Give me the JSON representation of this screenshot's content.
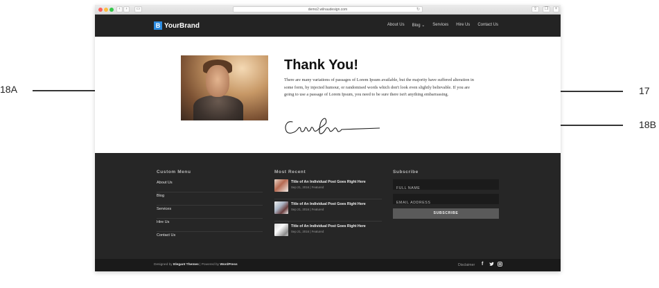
{
  "annotations": [
    {
      "id": "18A",
      "label": "18A"
    },
    {
      "id": "17",
      "label": "17"
    },
    {
      "id": "18B",
      "label": "18B"
    }
  ],
  "browser": {
    "url": "demo2.wilnaudesign.com"
  },
  "header": {
    "logo_mark": "B",
    "brand": "YourBrand",
    "nav": [
      {
        "label": "About Us"
      },
      {
        "label": "Blog ⌄"
      },
      {
        "label": "Services"
      },
      {
        "label": "Hire Us"
      },
      {
        "label": "Contact Us"
      }
    ]
  },
  "hero": {
    "title": "Thank You!",
    "body": "There are many variations of passages of Lorem Ipsum available, but the majority have suffered alteration in some form, by injected humour, or randomised words which don't look even slightly believable. If you are going to use a passage of Lorem Ipsum, you need to be sure there isn't anything embarrassing."
  },
  "footer": {
    "custom_menu": {
      "title": "Custom Menu",
      "items": [
        {
          "label": "About Us"
        },
        {
          "label": "Blog"
        },
        {
          "label": "Services"
        },
        {
          "label": "Hire Us"
        },
        {
          "label": "Contact Us"
        }
      ]
    },
    "most_recent": {
      "title": "Most Recent",
      "posts": [
        {
          "title": "Title of An Individual Post Goes Right Here",
          "meta": "Sep 21, 2016 | Featured"
        },
        {
          "title": "Title of An Individual Post Goes Right Here",
          "meta": "Sep 21, 2016 | Featured"
        },
        {
          "title": "Title of An Individual Post Goes Right Here",
          "meta": "Sep 21, 2016 | Featured"
        }
      ]
    },
    "subscribe": {
      "title": "Subscribe",
      "full_name_placeholder": "FULL NAME",
      "email_placeholder": "EMAIL ADDRESS",
      "button": "SUBSCRIBE"
    }
  },
  "bottom_bar": {
    "designed_by": "Designed by",
    "theme": "Elegant Themes",
    "powered_by": "| Powered by",
    "platform": "WordPress",
    "disclaimer": "Disclaimer",
    "social": [
      {
        "icon": "facebook-icon",
        "glyph": "f"
      },
      {
        "icon": "twitter-icon",
        "glyph": "t"
      },
      {
        "icon": "instagram-icon",
        "glyph": "◙"
      }
    ]
  },
  "colors": {
    "header_bg": "#232323",
    "footer_bg": "#262626",
    "brand_accent": "#2d8de2"
  }
}
